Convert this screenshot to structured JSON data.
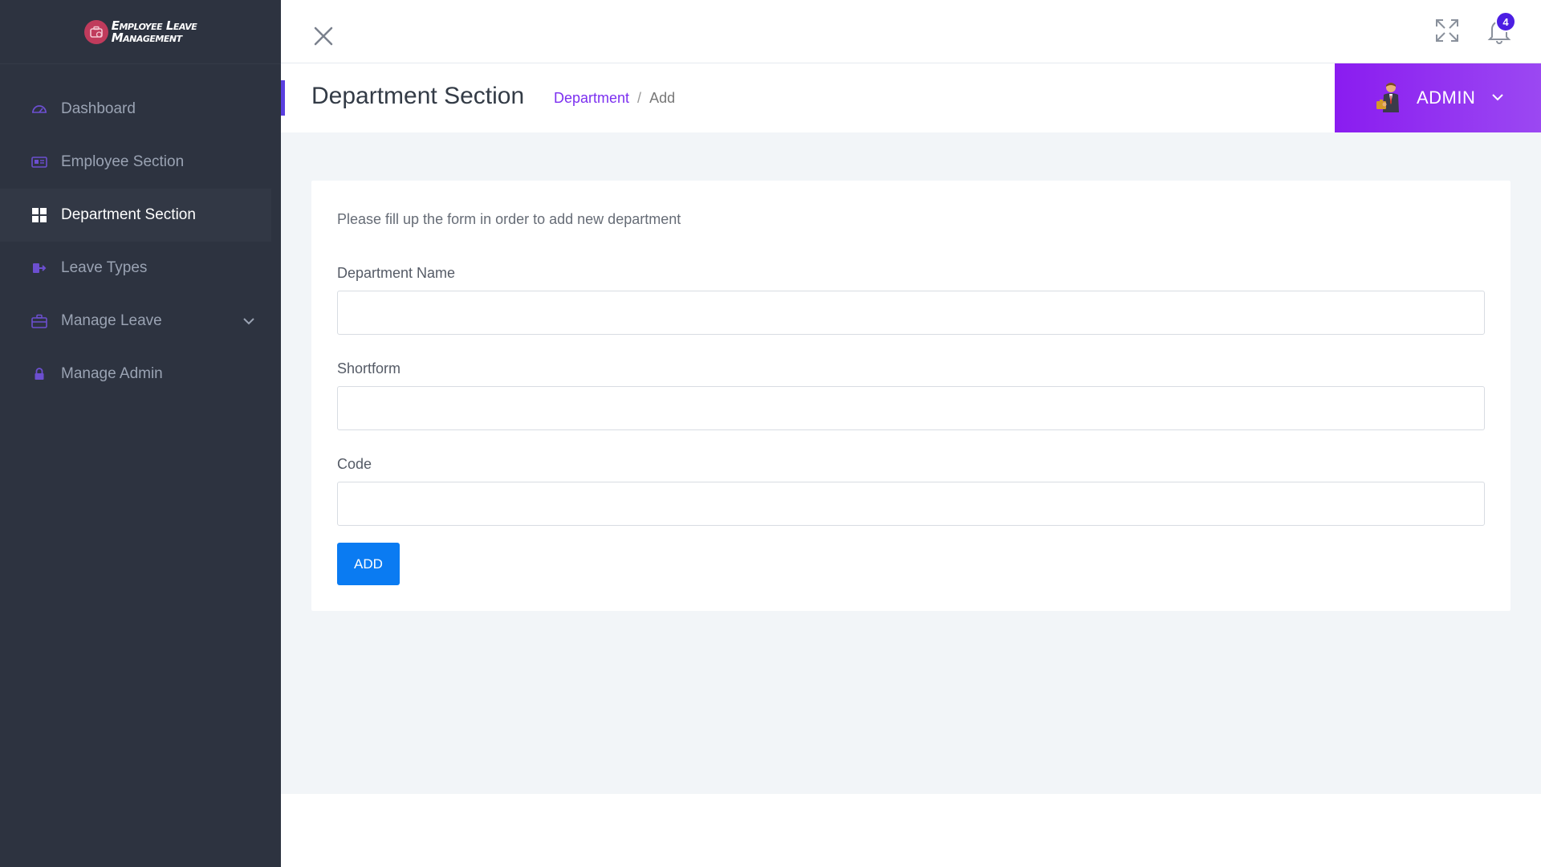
{
  "app": {
    "logo_line1": "Employee Leave",
    "logo_line2": "Management"
  },
  "sidebar": {
    "items": [
      {
        "label": "Dashboard",
        "icon": "dashboard-gauge-icon",
        "active": false
      },
      {
        "label": "Employee Section",
        "icon": "id-card-icon",
        "active": false
      },
      {
        "label": "Department Section",
        "icon": "grid-icon",
        "active": true
      },
      {
        "label": "Leave Types",
        "icon": "sign-out-icon",
        "active": false
      },
      {
        "label": "Manage Leave",
        "icon": "briefcase-icon",
        "active": false,
        "expandable": true
      },
      {
        "label": "Manage Admin",
        "icon": "lock-icon",
        "active": false
      }
    ]
  },
  "topbar": {
    "notification_count": "4"
  },
  "header": {
    "title": "Department Section",
    "breadcrumb_link": "Department",
    "breadcrumb_separator": "/",
    "breadcrumb_current": "Add",
    "user_name": "ADMIN"
  },
  "form": {
    "intro": "Please fill up the form in order to add new department",
    "fields": [
      {
        "label": "Department Name",
        "value": "",
        "placeholder": ""
      },
      {
        "label": "Shortform",
        "value": "",
        "placeholder": ""
      },
      {
        "label": "Code",
        "value": "",
        "placeholder": ""
      }
    ],
    "submit_label": "ADD"
  },
  "colors": {
    "sidebar_bg": "#2d3340",
    "accent_purple": "#8a1cf0",
    "link_purple": "#7c2ff0",
    "button_blue": "#0a7bf2",
    "badge_blue": "#4c1ee3",
    "content_bg": "#f2f5f8"
  }
}
